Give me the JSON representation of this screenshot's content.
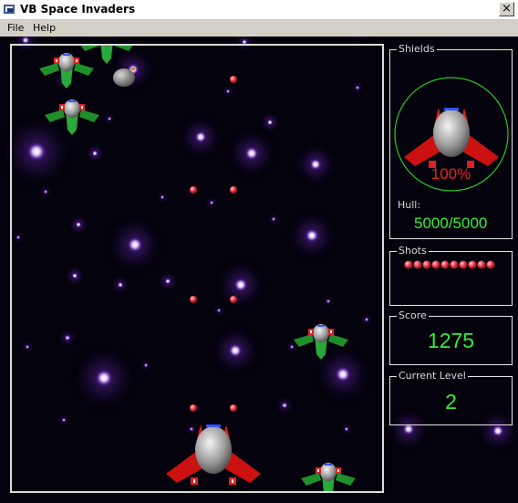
{
  "window": {
    "title": "VB Space Invaders",
    "close_glyph": "×",
    "icon": "app-icon"
  },
  "menu": {
    "file": "File",
    "help": "Help"
  },
  "shields": {
    "label": "Shields",
    "percent_text": "100%",
    "hull_label": "Hull:",
    "hull_value": "5000/5000"
  },
  "shots": {
    "label": "Shots",
    "count": 10
  },
  "score": {
    "label": "Score",
    "value": "1275"
  },
  "level": {
    "label": "Current Level",
    "value": "2"
  },
  "colors": {
    "readout": "#33ee33",
    "percent": "#ee2222",
    "bullet": "#ff3344",
    "ring": "#22cc22"
  }
}
